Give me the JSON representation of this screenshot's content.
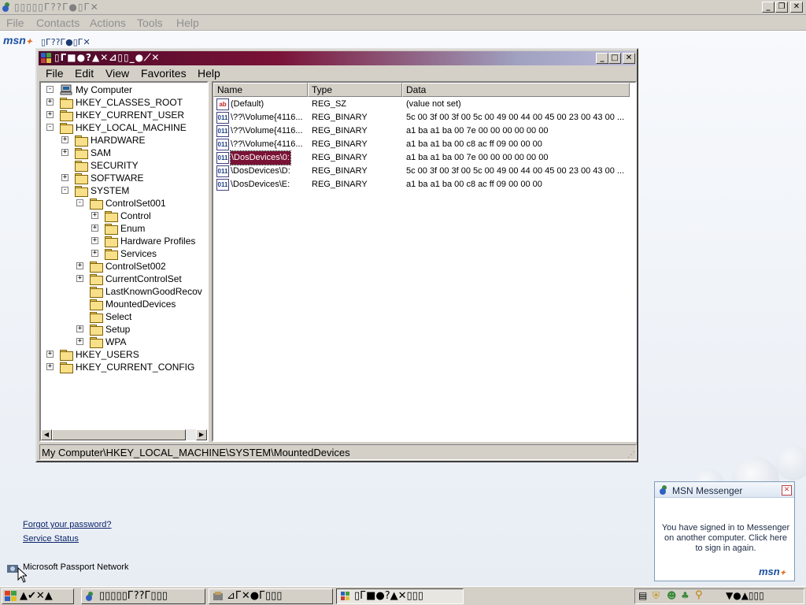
{
  "messenger": {
    "title": "▯▯▯▯▯Г??Г●▯Г✕",
    "menu": [
      "File",
      "Contacts",
      "Actions",
      "Tools",
      "Help"
    ],
    "brand": "msn",
    "brand_sub": "▯Г??Г●▯Г✕",
    "links": {
      "forgot": "Forgot your password?",
      "status": "Service Status"
    },
    "passport": "Microsoft Passport Network"
  },
  "regedit": {
    "title": "▯Г■●?▲✕⊿▯▯_●⟋✕",
    "menu": [
      "File",
      "Edit",
      "View",
      "Favorites",
      "Help"
    ],
    "tree": [
      {
        "label": "My Computer",
        "depth": 0,
        "expander": "-",
        "icon": "computer"
      },
      {
        "label": "HKEY_CLASSES_ROOT",
        "depth": 1,
        "expander": "+",
        "icon": "folder"
      },
      {
        "label": "HKEY_CURRENT_USER",
        "depth": 1,
        "expander": "+",
        "icon": "folder"
      },
      {
        "label": "HKEY_LOCAL_MACHINE",
        "depth": 1,
        "expander": "-",
        "icon": "folder"
      },
      {
        "label": "HARDWARE",
        "depth": 2,
        "expander": "+",
        "icon": "folder"
      },
      {
        "label": "SAM",
        "depth": 2,
        "expander": "+",
        "icon": "folder"
      },
      {
        "label": "SECURITY",
        "depth": 2,
        "expander": "",
        "icon": "folder"
      },
      {
        "label": "SOFTWARE",
        "depth": 2,
        "expander": "+",
        "icon": "folder"
      },
      {
        "label": "SYSTEM",
        "depth": 2,
        "expander": "-",
        "icon": "folder"
      },
      {
        "label": "ControlSet001",
        "depth": 3,
        "expander": "-",
        "icon": "folder"
      },
      {
        "label": "Control",
        "depth": 4,
        "expander": "+",
        "icon": "folder"
      },
      {
        "label": "Enum",
        "depth": 4,
        "expander": "+",
        "icon": "folder"
      },
      {
        "label": "Hardware Profiles",
        "depth": 4,
        "expander": "+",
        "icon": "folder"
      },
      {
        "label": "Services",
        "depth": 4,
        "expander": "+",
        "icon": "folder"
      },
      {
        "label": "ControlSet002",
        "depth": 3,
        "expander": "+",
        "icon": "folder"
      },
      {
        "label": "CurrentControlSet",
        "depth": 3,
        "expander": "+",
        "icon": "folder"
      },
      {
        "label": "LastKnownGoodRecov",
        "depth": 3,
        "expander": "",
        "icon": "folder"
      },
      {
        "label": "MountedDevices",
        "depth": 3,
        "expander": "",
        "icon": "folder-open"
      },
      {
        "label": "Select",
        "depth": 3,
        "expander": "",
        "icon": "folder"
      },
      {
        "label": "Setup",
        "depth": 3,
        "expander": "+",
        "icon": "folder"
      },
      {
        "label": "WPA",
        "depth": 3,
        "expander": "+",
        "icon": "folder"
      },
      {
        "label": "HKEY_USERS",
        "depth": 1,
        "expander": "+",
        "icon": "folder"
      },
      {
        "label": "HKEY_CURRENT_CONFIG",
        "depth": 1,
        "expander": "+",
        "icon": "folder"
      }
    ],
    "columns": [
      "Name",
      "Type",
      "Data"
    ],
    "values": [
      {
        "name": "(Default)",
        "type": "REG_SZ",
        "data": "(value not set)",
        "icon": "ab",
        "selected": false
      },
      {
        "name": "\\??\\Volume{4116...",
        "type": "REG_BINARY",
        "data": "5c 00 3f 00 3f 00 5c 00 49 00 44 00 45 00 23 00 43 00 ...",
        "icon": "bin",
        "selected": false
      },
      {
        "name": "\\??\\Volume{4116...",
        "type": "REG_BINARY",
        "data": "a1 ba a1 ba 00 7e 00 00 00 00 00 00",
        "icon": "bin",
        "selected": false
      },
      {
        "name": "\\??\\Volume{4116...",
        "type": "REG_BINARY",
        "data": "a1 ba a1 ba 00 c8 ac ff 09 00 00 00",
        "icon": "bin",
        "selected": false
      },
      {
        "name": "\\DosDevices\\0:",
        "type": "REG_BINARY",
        "data": "a1 ba a1 ba 00 7e 00 00 00 00 00 00",
        "icon": "bin",
        "selected": true
      },
      {
        "name": "\\DosDevices\\D:",
        "type": "REG_BINARY",
        "data": "5c 00 3f 00 3f 00 5c 00 49 00 44 00 45 00 23 00 43 00 ...",
        "icon": "bin",
        "selected": false
      },
      {
        "name": "\\DosDevices\\E:",
        "type": "REG_BINARY",
        "data": "a1 ba a1 ba 00 c8 ac ff 09 00 00 00",
        "icon": "bin",
        "selected": false
      }
    ],
    "status": "My Computer\\HKEY_LOCAL_MACHINE\\SYSTEM\\MountedDevices"
  },
  "toast": {
    "title": "MSN Messenger",
    "message": "You have signed in to Messenger on another computer. Click here to sign in again.",
    "brand": "msn"
  },
  "taskbar": {
    "start": "▲✔✕▲",
    "tasks": [
      {
        "label": "▯▯▯▯▯Г??Г▯▯▯",
        "active": false
      },
      {
        "label": "⊿Г✕●Г▯▯▯",
        "active": false
      },
      {
        "label": "▯Г■●?▲✕▯▯▯",
        "active": true
      }
    ],
    "clock": "▼●▲▯▯▯"
  },
  "colors": {
    "title_active": "#7a1236",
    "selection": "#7a1236",
    "link": "#0a246a"
  }
}
